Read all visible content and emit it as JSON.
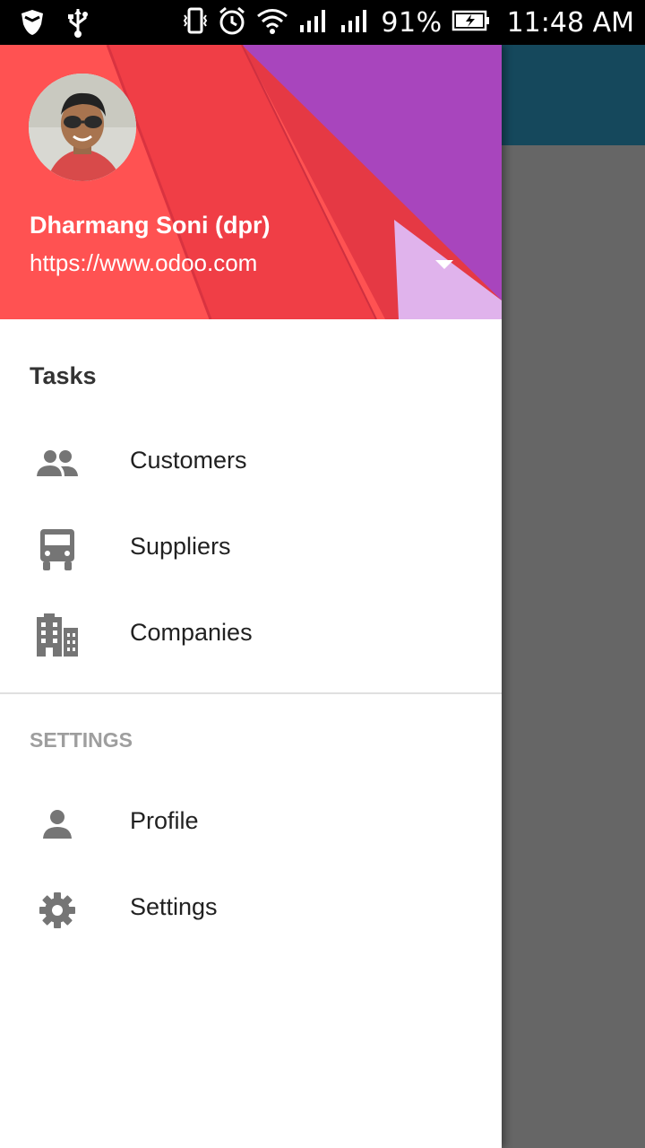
{
  "status_bar": {
    "battery": "91%",
    "time": "11:48 AM"
  },
  "drawer": {
    "header": {
      "user_name": "Dharmang Soni (dpr)",
      "user_url": "https://www.odoo.com"
    },
    "sections": [
      {
        "title": "Tasks",
        "items": [
          {
            "label": "Customers",
            "icon": "people-icon"
          },
          {
            "label": "Suppliers",
            "icon": "truck-icon"
          },
          {
            "label": "Companies",
            "icon": "building-icon"
          }
        ]
      },
      {
        "title": "SETTINGS",
        "items": [
          {
            "label": "Profile",
            "icon": "person-icon"
          },
          {
            "label": "Settings",
            "icon": "gear-icon"
          }
        ]
      }
    ]
  },
  "colors": {
    "app_bar": "#15485c",
    "scrim": "#666666",
    "icon_grey": "#757575"
  }
}
